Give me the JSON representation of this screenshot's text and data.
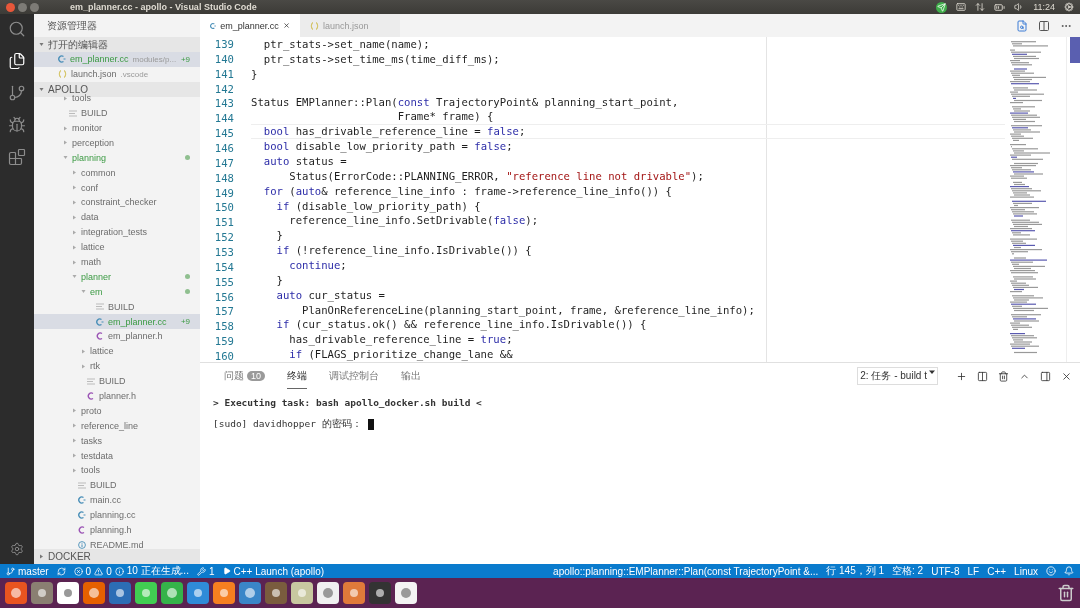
{
  "system_bar": {
    "title": "em_planner.cc - apollo - Visual Studio Code",
    "clock": "11:24"
  },
  "explorer": {
    "title": "资源管理器",
    "open_editors": {
      "title": "打开的编辑器",
      "expanded": true,
      "items": [
        {
          "name": "em_planner.cc",
          "detail": "modules/p...",
          "badge": "+9",
          "kind": "cc",
          "modified": true,
          "selected": true
        },
        {
          "name": "launch.json",
          "detail": ".vscode",
          "kind": "json",
          "modified": false,
          "selected": false
        }
      ]
    },
    "project": {
      "title": "APOLLO",
      "expanded": true,
      "tree": [
        {
          "name": "tools",
          "kind": "folder",
          "expanded": false,
          "modified": false,
          "selected": false
        },
        {
          "name": "BUILD",
          "kind": "build",
          "modified": false,
          "selected": false
        },
        {
          "name": "monitor",
          "kind": "folder",
          "expanded": false,
          "modified": false,
          "selected": false
        },
        {
          "name": "perception",
          "kind": "folder",
          "expanded": false,
          "modified": false,
          "selected": false
        },
        {
          "name": "planning",
          "kind": "folder",
          "expanded": true,
          "modified": true,
          "selected": false,
          "children": [
            {
              "name": "common",
              "kind": "folder",
              "expanded": false,
              "modified": false,
              "selected": false
            },
            {
              "name": "conf",
              "kind": "folder",
              "expanded": false,
              "modified": false,
              "selected": false
            },
            {
              "name": "constraint_checker",
              "kind": "folder",
              "expanded": false,
              "modified": false,
              "selected": false
            },
            {
              "name": "data",
              "kind": "folder",
              "expanded": false,
              "modified": false,
              "selected": false
            },
            {
              "name": "integration_tests",
              "kind": "folder",
              "expanded": false,
              "modified": false,
              "selected": false
            },
            {
              "name": "lattice",
              "kind": "folder",
              "expanded": false,
              "modified": false,
              "selected": false
            },
            {
              "name": "math",
              "kind": "folder",
              "expanded": false,
              "modified": false,
              "selected": false
            },
            {
              "name": "planner",
              "kind": "folder",
              "expanded": true,
              "modified": true,
              "selected": false,
              "children": [
                {
                  "name": "em",
                  "kind": "folder",
                  "expanded": true,
                  "modified": true,
                  "selected": false,
                  "children": [
                    {
                      "name": "BUILD",
                      "kind": "build",
                      "modified": false,
                      "selected": false
                    },
                    {
                      "name": "em_planner.cc",
                      "kind": "cc",
                      "badge": "+9",
                      "modified": true,
                      "selected": true
                    },
                    {
                      "name": "em_planner.h",
                      "kind": "h",
                      "modified": false,
                      "selected": false
                    }
                  ]
                },
                {
                  "name": "lattice",
                  "kind": "folder",
                  "expanded": false,
                  "modified": false,
                  "selected": false
                },
                {
                  "name": "rtk",
                  "kind": "folder",
                  "expanded": false,
                  "modified": false,
                  "selected": false
                },
                {
                  "name": "BUILD",
                  "kind": "build",
                  "modified": false,
                  "selected": false
                },
                {
                  "name": "planner.h",
                  "kind": "h",
                  "modified": false,
                  "selected": false
                }
              ]
            },
            {
              "name": "proto",
              "kind": "folder",
              "expanded": false,
              "modified": false,
              "selected": false
            },
            {
              "name": "reference_line",
              "kind": "folder",
              "expanded": false,
              "modified": false,
              "selected": false
            },
            {
              "name": "tasks",
              "kind": "folder",
              "expanded": false,
              "modified": false,
              "selected": false
            },
            {
              "name": "testdata",
              "kind": "folder",
              "expanded": false,
              "modified": false,
              "selected": false
            },
            {
              "name": "tools",
              "kind": "folder",
              "expanded": false,
              "modified": false,
              "selected": false
            },
            {
              "name": "BUILD",
              "kind": "build",
              "modified": false,
              "selected": false
            },
            {
              "name": "main.cc",
              "kind": "cc",
              "modified": false,
              "selected": false
            },
            {
              "name": "planning.cc",
              "kind": "cc",
              "modified": false,
              "selected": false
            },
            {
              "name": "planning.h",
              "kind": "h",
              "modified": false,
              "selected": false
            },
            {
              "name": "README.md",
              "kind": "md",
              "modified": false,
              "selected": false
            }
          ]
        }
      ]
    },
    "docker": {
      "title": "DOCKER",
      "expanded": false
    }
  },
  "tabs": [
    {
      "label": "em_planner.cc",
      "kind": "cc",
      "selected": true
    },
    {
      "label": "launch.json",
      "kind": "json",
      "selected": false
    }
  ],
  "code": [
    {
      "number": "139",
      "current": false,
      "tokens": [
        {
          "kind": "text",
          "text": "  ptr_stats->set_name(name);"
        }
      ]
    },
    {
      "number": "140",
      "current": false,
      "tokens": [
        {
          "kind": "text",
          "text": "  ptr_stats->set_time_ms(time_diff_ms);"
        }
      ]
    },
    {
      "number": "141",
      "current": false,
      "tokens": [
        {
          "kind": "text",
          "text": "}"
        }
      ]
    },
    {
      "number": "142",
      "current": false
    },
    {
      "number": "143",
      "current": false,
      "tokens": [
        {
          "kind": "text",
          "text": "Status EMPlanner::Plan("
        },
        {
          "kind": "keyword",
          "text": "const"
        },
        {
          "kind": "text",
          "text": " TrajectoryPoint& planning_start_point,"
        }
      ]
    },
    {
      "number": "144",
      "current": false,
      "tokens": [
        {
          "kind": "text",
          "text": "                       Frame* frame) {"
        }
      ]
    },
    {
      "number": "145",
      "current": true,
      "tokens": [
        {
          "kind": "keyword",
          "text": "  bool"
        },
        {
          "kind": "text",
          "text": " has_drivable_reference_line = "
        },
        {
          "kind": "keyword",
          "text": "false"
        },
        {
          "kind": "text",
          "text": ";"
        }
      ]
    },
    {
      "number": "146",
      "current": false,
      "tokens": [
        {
          "kind": "keyword",
          "text": "  bool"
        },
        {
          "kind": "text",
          "text": " disable_low_priority_path = "
        },
        {
          "kind": "keyword",
          "text": "false"
        },
        {
          "kind": "text",
          "text": ";"
        }
      ]
    },
    {
      "number": "147",
      "current": false,
      "tokens": [
        {
          "kind": "keyword",
          "text": "  auto"
        },
        {
          "kind": "text",
          "text": " status ="
        }
      ]
    },
    {
      "number": "148",
      "current": false,
      "tokens": [
        {
          "kind": "text",
          "text": "      Status(ErrorCode::PLANNING_ERROR, "
        },
        {
          "kind": "string",
          "text": "\"reference line not drivable\""
        },
        {
          "kind": "text",
          "text": ");"
        }
      ]
    },
    {
      "number": "149",
      "current": false,
      "tokens": [
        {
          "kind": "keyword",
          "text": "  for"
        },
        {
          "kind": "text",
          "text": " ("
        },
        {
          "kind": "keyword",
          "text": "auto"
        },
        {
          "kind": "text",
          "text": "& reference_line_info : frame->reference_line_info()) {"
        }
      ]
    },
    {
      "number": "150",
      "current": false,
      "tokens": [
        {
          "kind": "keyword",
          "text": "    if"
        },
        {
          "kind": "text",
          "text": " (disable_low_priority_path) {"
        }
      ]
    },
    {
      "number": "151",
      "current": false,
      "tokens": [
        {
          "kind": "text",
          "text": "      reference_line_info.SetDrivable("
        },
        {
          "kind": "keyword",
          "text": "false"
        },
        {
          "kind": "text",
          "text": ");"
        }
      ]
    },
    {
      "number": "152",
      "current": false,
      "tokens": [
        {
          "kind": "text",
          "text": "    }"
        }
      ]
    },
    {
      "number": "153",
      "current": false,
      "tokens": [
        {
          "kind": "keyword",
          "text": "    if"
        },
        {
          "kind": "text",
          "text": " (!reference_line_info.IsDrivable()) {"
        }
      ]
    },
    {
      "number": "154",
      "current": false,
      "tokens": [
        {
          "kind": "keyword",
          "text": "      continue"
        },
        {
          "kind": "text",
          "text": ";"
        }
      ]
    },
    {
      "number": "155",
      "current": false,
      "tokens": [
        {
          "kind": "text",
          "text": "    }"
        }
      ]
    },
    {
      "number": "156",
      "current": false,
      "tokens": [
        {
          "kind": "keyword",
          "text": "    auto"
        },
        {
          "kind": "text",
          "text": " cur_status ="
        }
      ]
    },
    {
      "number": "157",
      "current": false,
      "tokens": [
        {
          "kind": "text",
          "text": "        PlanOnReferenceLine(planning_start_point, frame, &reference_line_info);"
        }
      ]
    },
    {
      "number": "158",
      "current": false,
      "tokens": [
        {
          "kind": "keyword",
          "text": "    if"
        },
        {
          "kind": "text",
          "text": " (cur_status.ok() && reference_line_info.IsDrivable()) {"
        }
      ]
    },
    {
      "number": "159",
      "current": false,
      "tokens": [
        {
          "kind": "text",
          "text": "      has_drivable_reference_line = "
        },
        {
          "kind": "keyword",
          "text": "true"
        },
        {
          "kind": "text",
          "text": ";"
        }
      ]
    },
    {
      "number": "160",
      "current": false,
      "tokens": [
        {
          "kind": "keyword",
          "text": "      if"
        },
        {
          "kind": "text",
          "text": " (FLAGS_prioritize_change_lane &&"
        }
      ]
    }
  ],
  "panel": {
    "tabs": [
      {
        "label": "问题",
        "badge": "10",
        "selected": false
      },
      {
        "label": "终端",
        "selected": true
      },
      {
        "label": "调试控制台",
        "selected": false
      },
      {
        "label": "输出",
        "selected": false
      }
    ],
    "terminal_picker": "2: 任务 - build t",
    "terminal": [
      {
        "kind": "bold",
        "text": "> Executing task: bash apollo_docker.sh build <"
      },
      {
        "kind": "prompt",
        "text": "[sudo] davidhopper 的密码："
      }
    ]
  },
  "status_bar": {
    "branch": "master",
    "errors": "0",
    "warnings": "0",
    "info": "10 正在生成...",
    "tasks": "1",
    "launch": "C++ Launch (apollo)",
    "right": [
      "apollo::planning::EMPlanner::Plan(const TrajectoryPoint &...",
      "行 145，列 1",
      "空格: 2",
      "UTF-8",
      "LF",
      "C++",
      "Linux"
    ]
  }
}
